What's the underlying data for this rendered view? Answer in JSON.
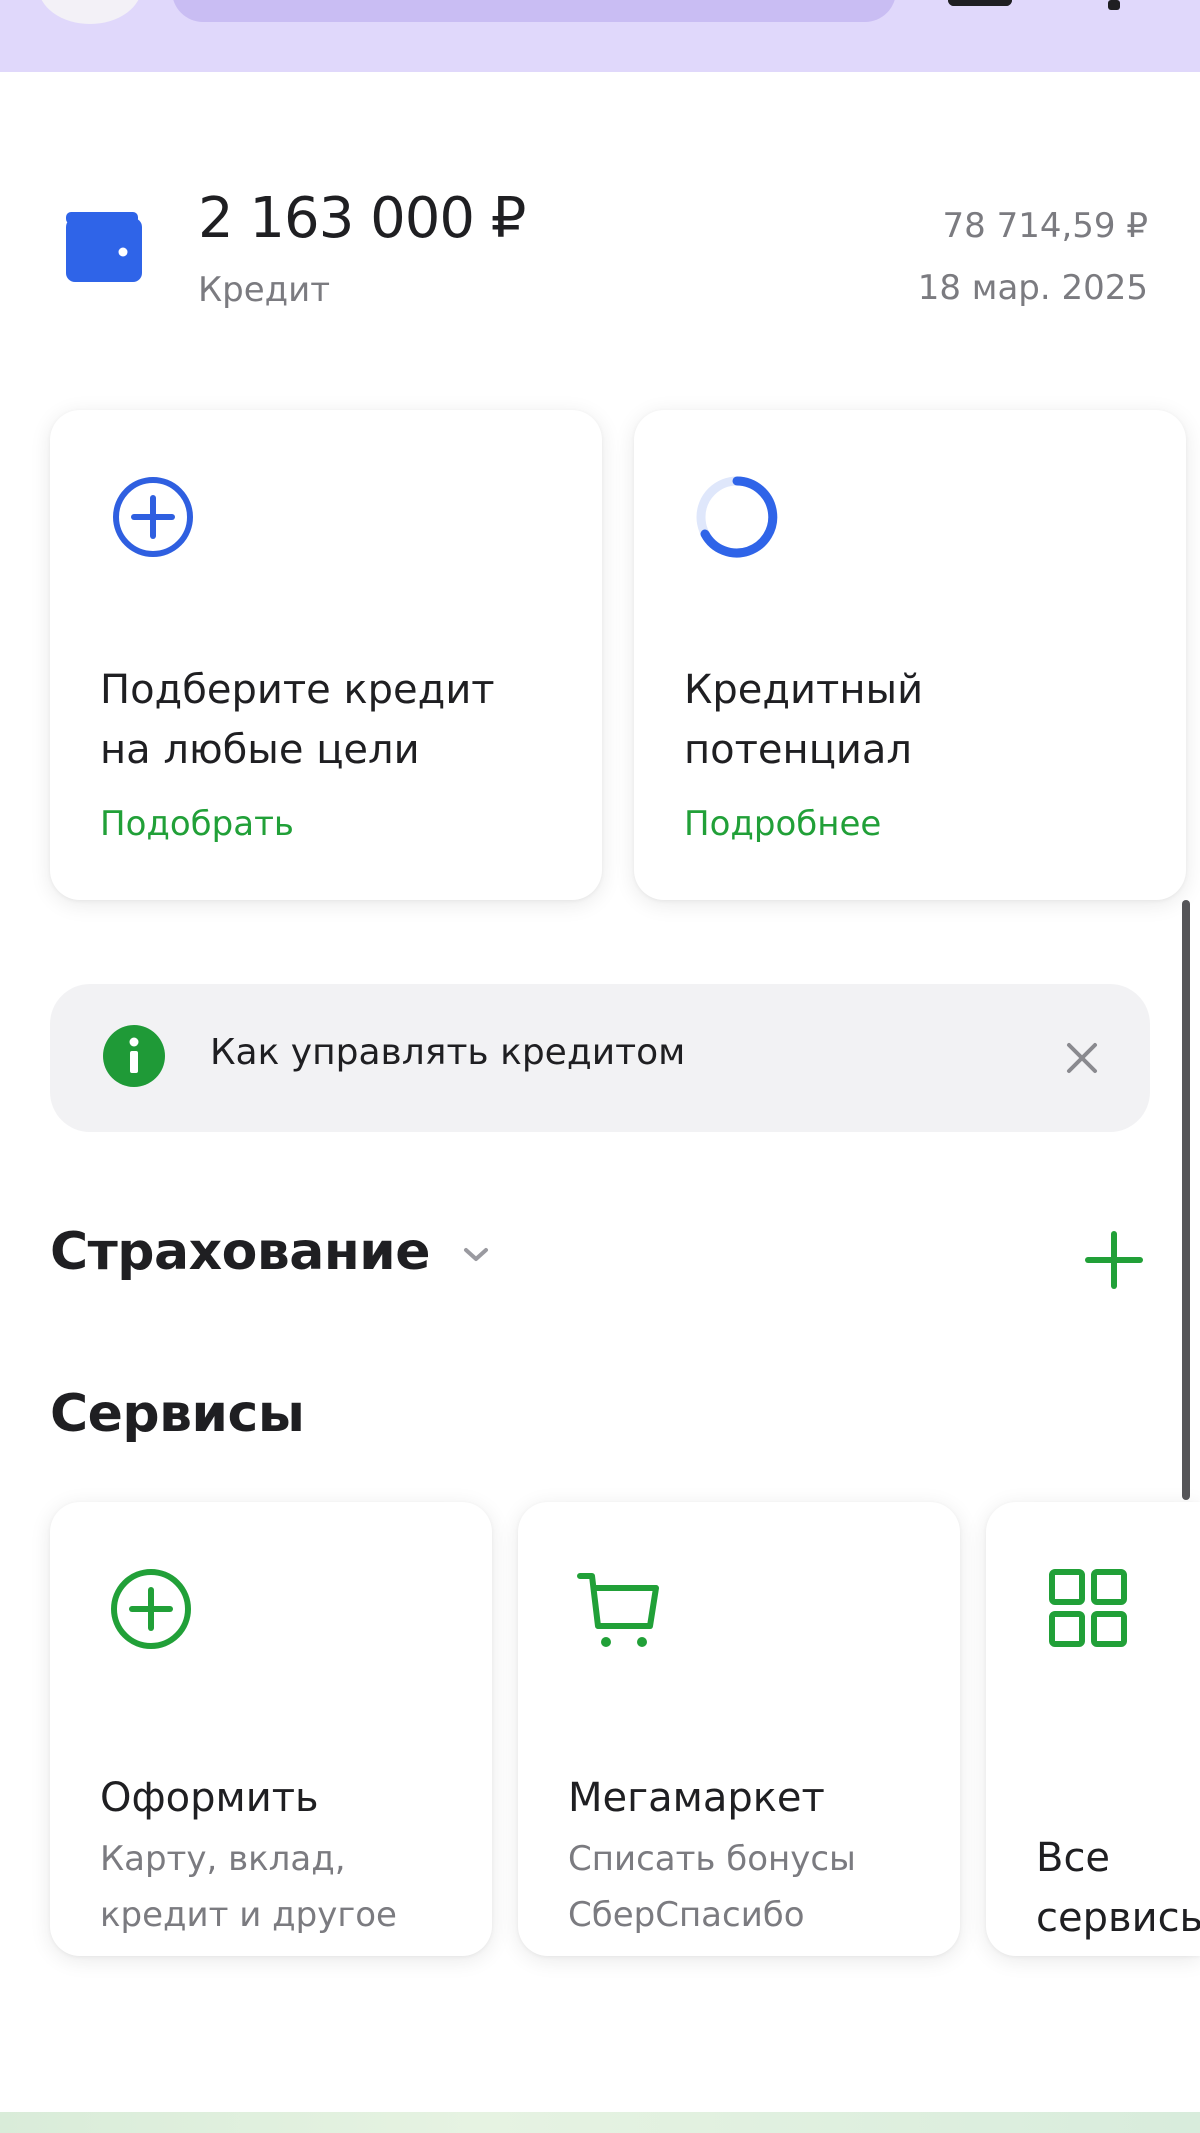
{
  "credit": {
    "amount": "2 163 000 ₽",
    "label": "Кредит",
    "payment": "78 714,59 ₽",
    "date": "18 мар. 2025"
  },
  "cards": {
    "pick_credit": {
      "title_line1": "Подберите кредит",
      "title_line2": "на любые цели",
      "link": "Подобрать"
    },
    "credit_potential": {
      "title_line1": "Кредитный",
      "title_line2": "потенциал",
      "link": "Подробнее"
    }
  },
  "banner": {
    "text": "Как управлять кредитом"
  },
  "sections": {
    "insurance": "Страхование",
    "services": "Сервисы"
  },
  "services": {
    "apply": {
      "title": "Оформить",
      "sub_line1": "Карту, вклад,",
      "sub_line2": "кредит и другое"
    },
    "megamarket": {
      "title": "Мегамаркет",
      "sub_line1": "Списать бонусы",
      "sub_line2": "СберСпасибо"
    },
    "all": {
      "title_line1": "Все",
      "title_line2": "сервисы"
    }
  },
  "colors": {
    "green": "#21a038",
    "blue": "#2f5fe0",
    "topbar": "#e0d8fb"
  },
  "icons": [
    "wallet-icon",
    "plus-circle-icon",
    "progress-ring-icon",
    "info-icon",
    "close-icon",
    "chevron-down-icon",
    "plus-icon",
    "cart-icon",
    "grid-icon"
  ]
}
